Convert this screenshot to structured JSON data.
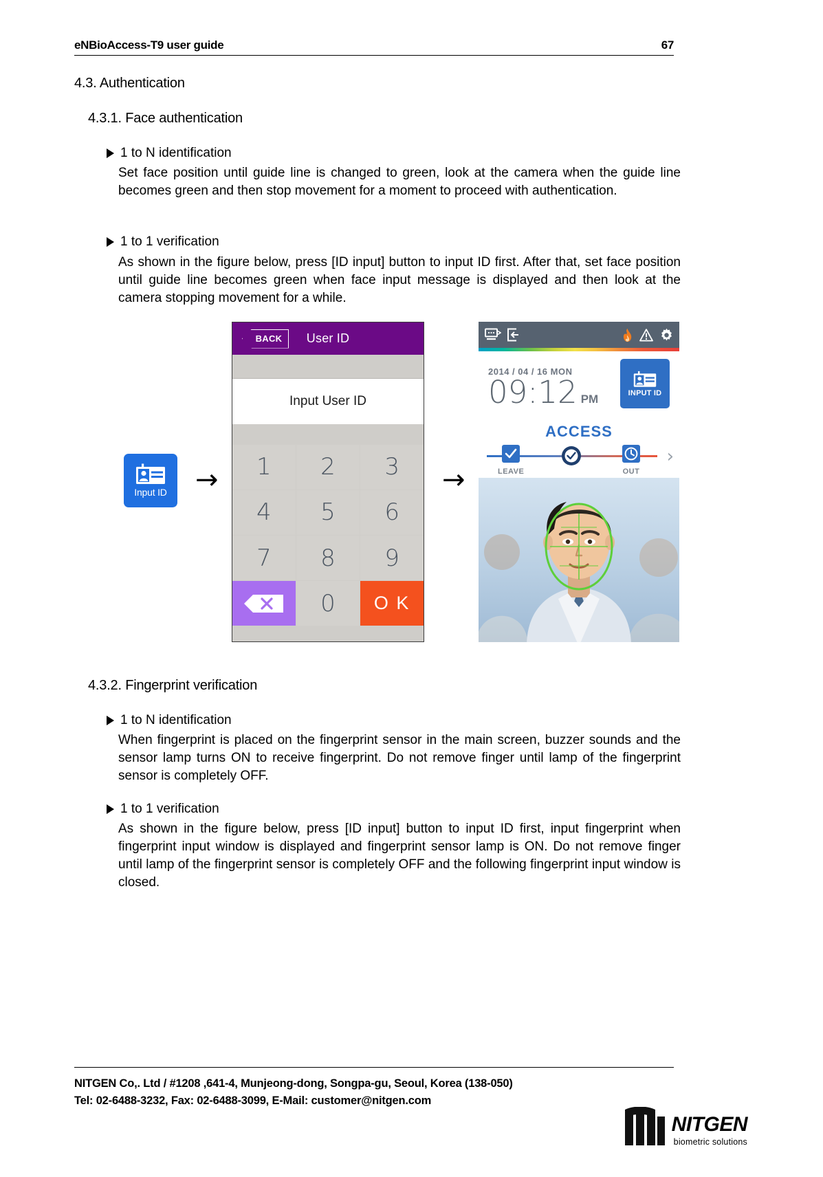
{
  "header": {
    "title": "eNBioAccess-T9 user guide",
    "page_number": "67"
  },
  "sections": {
    "s43": "4.3. Authentication",
    "s431": "4.3.1. Face authentication",
    "s432": "4.3.2. Fingerprint verification"
  },
  "face": {
    "b1_title": "1 to N identification",
    "b1_body": "Set face position until guide line is changed to green, look at the camera when the guide line becomes green and then stop movement for a moment to proceed with authentication.",
    "b2_title": "1 to 1 verification",
    "b2_body": "As shown in the figure below, press [ID input] button to input ID first. After that, set face position until guide line becomes green when face input message is displayed and then look at the camera stopping movement for a while."
  },
  "finger": {
    "b1_title": "1 to N identification",
    "b1_body": "When fingerprint is placed on the fingerprint sensor in the main screen, buzzer sounds and the sensor lamp turns ON to receive fingerprint. Do not remove finger until lamp of the fingerprint sensor is completely OFF.",
    "b2_title": "1 to 1 verification",
    "b2_body": "As shown in the figure below, press [ID input] button to input ID first, input fingerprint when fingerprint input window is displayed and fingerprint sensor lamp is ON. Do not remove finger until lamp of the fingerprint sensor is completely OFF and the following fingerprint input window is closed."
  },
  "figure": {
    "arrow1": "→",
    "arrow2": "→",
    "input_id_button": {
      "label": "Input ID",
      "color": "#1f6fe0",
      "icon": "id-card-icon"
    },
    "keypad_screen": {
      "back_label": "BACK",
      "title": "User ID",
      "prompt": "Input User ID",
      "keys": [
        "1",
        "2",
        "3",
        "4",
        "5",
        "6",
        "7",
        "8",
        "9"
      ],
      "backspace_label": "",
      "zero_label": "0",
      "ok_label": "O K",
      "colors": {
        "titlebar": "#6b0a86",
        "key": "#d3d1cd",
        "backspace": "#a86ef0",
        "ok": "#f4511e",
        "key_text": "#4c5662"
      }
    },
    "main_screen": {
      "status_icons": [
        "network-icon",
        "door-exit-icon",
        "flame-icon",
        "warning-icon",
        "gear-icon"
      ],
      "date": "2014 / 04 / 16 MON",
      "time": "09:12",
      "ampm": "PM",
      "input_id_label": "INPUT ID",
      "access_title": "ACCESS",
      "tabs": [
        {
          "label": "LEAVE",
          "icon": "check-box-icon"
        },
        {
          "label": "",
          "icon": "access-check-icon"
        },
        {
          "label": "OUT",
          "icon": "clock-icon"
        }
      ],
      "chevron": "›",
      "colors": {
        "statusbar": "#566270",
        "accent": "#2f6fc4",
        "guide_line": "#5ecf3a"
      }
    }
  },
  "footer": {
    "line1": "NITGEN Co,. Ltd / #1208 ,641-4, Munjeong-dong, Songpa-gu, Seoul, Korea (138-050)",
    "line2": "Tel: 02-6488-3232, Fax: 02-6488-3099, E-Mail: customer@nitgen.com",
    "logo_word": "NITGEN",
    "logo_sub": "biometric solutions"
  }
}
